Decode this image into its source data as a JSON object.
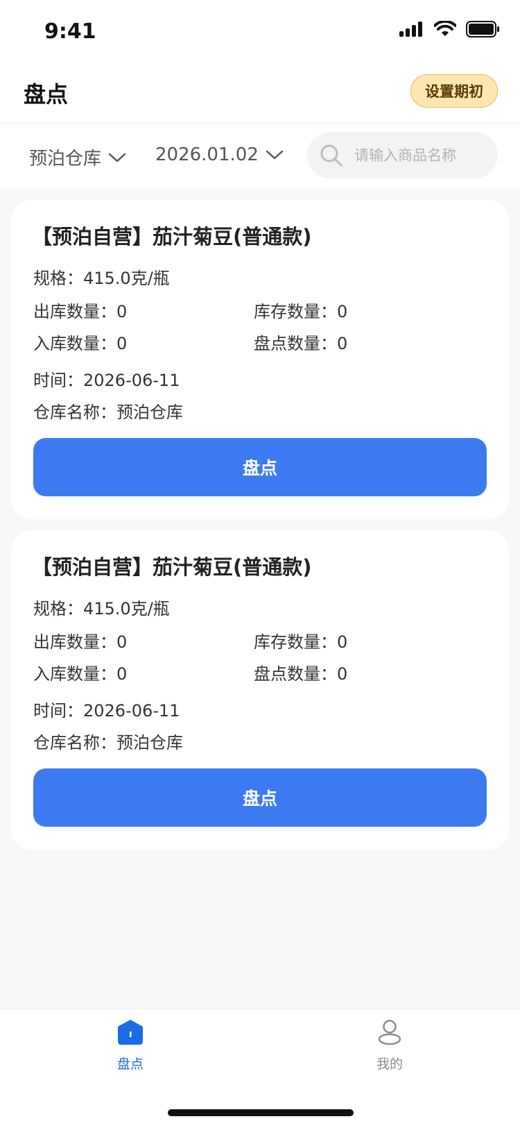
{
  "status": {
    "time": "9:41"
  },
  "header": {
    "title": "盘点",
    "init_button": "设置期初"
  },
  "filters": {
    "warehouse": "预泊仓库",
    "date": "2026.01.02",
    "search_placeholder": "请输入商品名称"
  },
  "cards": [
    {
      "title": "【预泊自营】茄汁菊豆(普通款)",
      "spec": "规格：415.0克/瓶",
      "out_qty": "出库数量：0",
      "stock_qty": "库存数量：0",
      "in_qty": "入库数量：0",
      "count_qty": "盘点数量：0",
      "time": "时间：2026-06-11",
      "warehouse": "仓库名称：预泊仓库",
      "button": "盘点"
    },
    {
      "title": "【预泊自营】茄汁菊豆(普通款)",
      "spec": "规格：415.0克/瓶",
      "out_qty": "出库数量：0",
      "stock_qty": "库存数量：0",
      "in_qty": "入库数量：0",
      "count_qty": "盘点数量：0",
      "time": "时间：2026-06-11",
      "warehouse": "仓库名称：预泊仓库",
      "button": "盘点"
    }
  ],
  "tabbar": {
    "items": [
      {
        "label": "盘点",
        "active": true
      },
      {
        "label": "我的",
        "active": false
      }
    ]
  },
  "colors": {
    "accent": "#3c7af1",
    "tab_active": "#1e6be6",
    "tab_inactive": "#8c8c8c"
  }
}
